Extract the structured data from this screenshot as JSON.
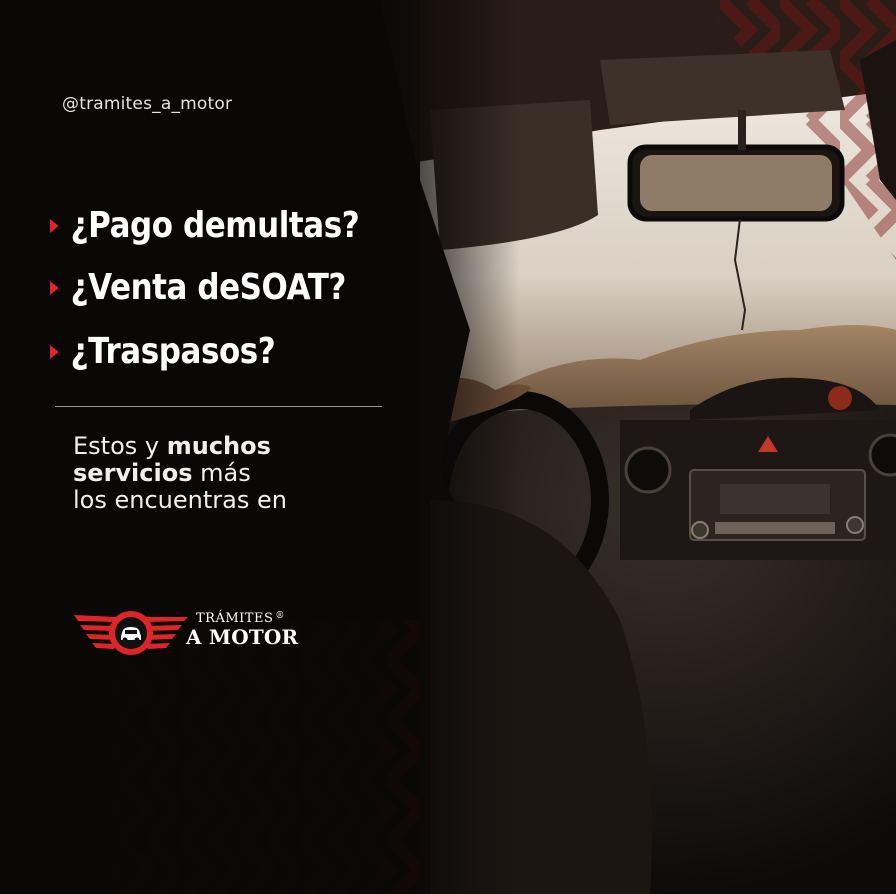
{
  "handle": "@tramites_a_motor",
  "questions": [
    {
      "pre": "¿Pago de ",
      "bold": "multas?"
    },
    {
      "pre": "¿Venta de ",
      "bold": "SOAT?"
    },
    {
      "pre": "",
      "bold": "¿Traspasos?"
    }
  ],
  "services": {
    "line1_pre": "Estos y ",
    "line1_bold": "muchos",
    "line2_bold": "servicios",
    "line2_post": " más",
    "line3": "los encuentras en"
  },
  "logo": {
    "line1": "TRÁMITES",
    "reg": "®",
    "line2": "A MOTOR"
  },
  "colors": {
    "accent": "#e0252a",
    "text": "#ffffff"
  },
  "icons": [
    "play-arrow-icon",
    "winged-car-logo-icon"
  ]
}
